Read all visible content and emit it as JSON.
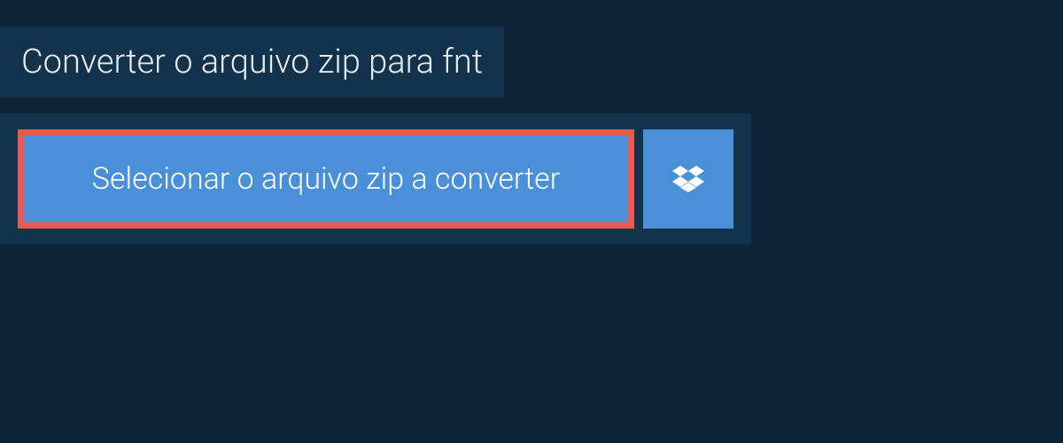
{
  "header": {
    "title": "Converter o arquivo zip para fnt"
  },
  "upload": {
    "select_label": "Selecionar o arquivo zip a converter",
    "highlight_color": "#e85a4f"
  },
  "colors": {
    "page_bg": "#0d2438",
    "panel_bg": "#13324b",
    "button_bg": "#4a90d9",
    "text_light": "#e8edf2",
    "text_white": "#ffffff"
  }
}
